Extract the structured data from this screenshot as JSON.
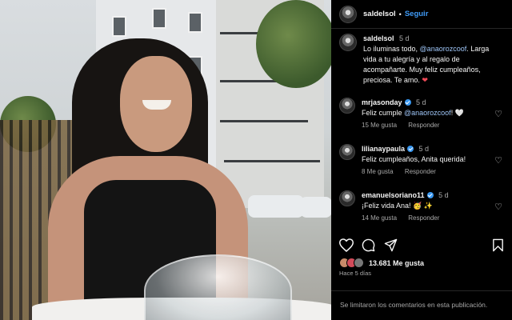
{
  "post": {
    "author": "saldelsol",
    "follow_label": "Seguir",
    "dot": "•"
  },
  "caption": {
    "user": "saldelsol",
    "time": "5 d",
    "text_before": "Lo iluminas todo, ",
    "mention": "@anaorozcoof",
    "text_after": ". Larga vida a tu alegría y al regalo de acompañarte. Muy feliz cumpleaños, preciosa. Te amo. ",
    "emoji": "❤"
  },
  "comments": [
    {
      "user": "mrjasonday",
      "time": "5 d",
      "text_before": "Feliz cumple ",
      "mention": "@anaorozcoof",
      "text_after": "! 🤍",
      "likes": "15 Me gusta",
      "reply": "Responder"
    },
    {
      "user": "lilianaypaula",
      "time": "5 d",
      "text_before": "Feliz cumpleaños, Anita querida!",
      "mention": "",
      "text_after": "",
      "likes": "8 Me gusta",
      "reply": "Responder"
    },
    {
      "user": "emanuelsoriano11",
      "time": "5 d",
      "text_before": "¡Feliz vida Ana! 🥳 ✨",
      "mention": "",
      "text_after": "",
      "likes": "14 Me gusta",
      "reply": "Responder"
    }
  ],
  "stats": {
    "likes": "13.681 Me gusta",
    "posted": "Hace 5 días"
  },
  "footer": {
    "comments_limited": "Se limitaron los comentarios en esta publicación."
  },
  "icons": {
    "heart": "heart-icon",
    "comment": "comment-icon",
    "share": "share-icon",
    "bookmark": "bookmark-icon"
  },
  "colors": {
    "background": "#000000",
    "accent_blue": "#3f9bf7",
    "mention": "#9fc6f8",
    "secondary_text": "#a8a8a8",
    "heart_red": "#ed4956"
  }
}
